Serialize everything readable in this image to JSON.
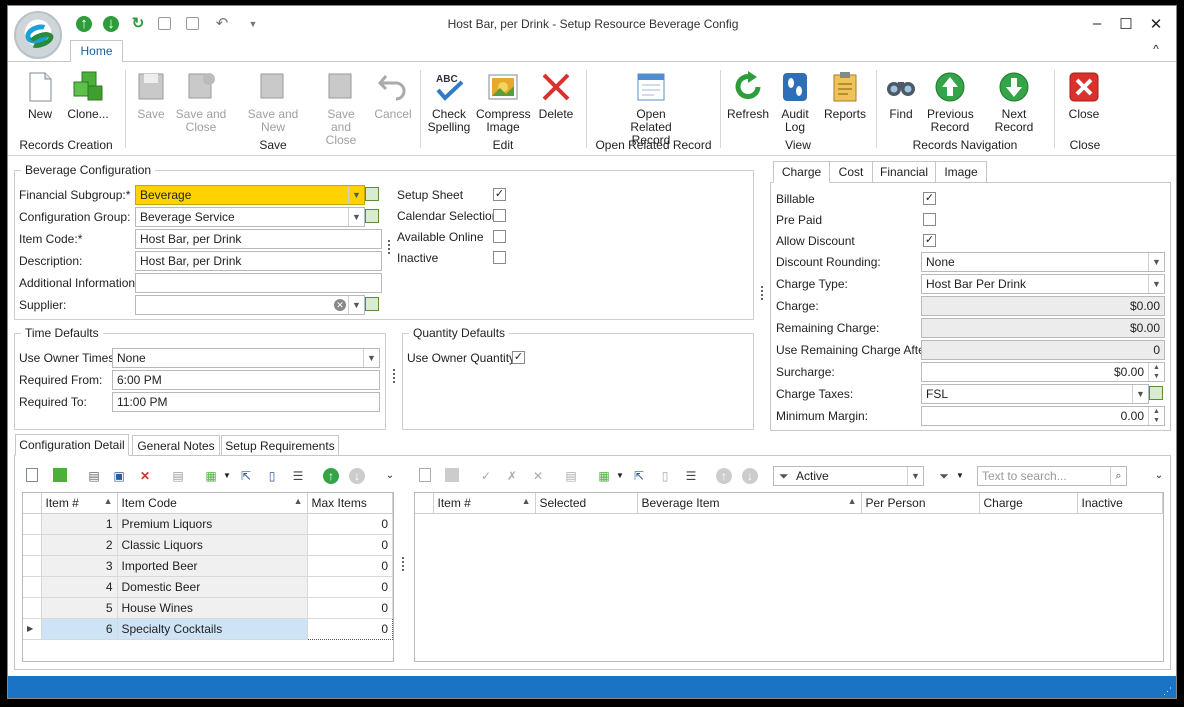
{
  "window": {
    "title": "Host Bar, per Drink - Setup Resource Beverage Config",
    "minimize": "–",
    "maximize": "☐",
    "close": "✕",
    "collapse": "^"
  },
  "ribbon": {
    "tab": "Home",
    "buttons": [
      {
        "label": "New"
      },
      {
        "label": "Clone..."
      },
      {
        "label": "Save"
      },
      {
        "label": "Save and Close"
      },
      {
        "label": "Save and New"
      },
      {
        "label": "Save and Close"
      },
      {
        "label": "Cancel"
      },
      {
        "label": "Check Spelling"
      },
      {
        "label": "Compress Image"
      },
      {
        "label": "Delete"
      },
      {
        "label": "Open Related Record"
      },
      {
        "label": "Refresh"
      },
      {
        "label": "Audit Log"
      },
      {
        "label": "Reports"
      },
      {
        "label": "Find"
      },
      {
        "label": "Previous Record"
      },
      {
        "label": "Next Record"
      },
      {
        "label": "Close"
      }
    ],
    "groups": [
      "Records Creation",
      "Save",
      "Edit",
      "Open Related Record",
      "View",
      "Records Navigation",
      "Close"
    ]
  },
  "beverage_config": {
    "legend": "Beverage Configuration",
    "financial_subgroup_label": "Financial Subgroup:*",
    "financial_subgroup": "Beverage",
    "config_group_label": "Configuration Group:",
    "config_group": "Beverage Service",
    "item_code_label": "Item Code:*",
    "item_code": "Host Bar, per Drink",
    "description_label": "Description:",
    "description": "Host Bar, per Drink",
    "additional_info_label": "Additional Information:",
    "additional_info": "",
    "supplier_label": "Supplier:",
    "supplier": "",
    "setup_sheet_label": "Setup Sheet",
    "calendar_selection_label": "Calendar Selection",
    "available_online_label": "Available Online",
    "inactive_label": "Inactive"
  },
  "time_defaults": {
    "legend": "Time Defaults",
    "use_owner_times_label": "Use Owner Times:",
    "use_owner_times": "None",
    "required_from_label": "Required From:",
    "required_from": "6:00 PM",
    "required_to_label": "Required To:",
    "required_to": "11:00 PM"
  },
  "quantity_defaults": {
    "legend": "Quantity Defaults",
    "use_owner_quantity_label": "Use Owner Quantity"
  },
  "right_tabs": [
    "Charge",
    "Cost",
    "Financial",
    "Image"
  ],
  "charge": {
    "billable_label": "Billable",
    "pre_paid_label": "Pre Paid",
    "allow_discount_label": "Allow Discount",
    "discount_rounding_label": "Discount Rounding:",
    "discount_rounding": "None",
    "charge_type_label": "Charge Type:",
    "charge_type": "Host Bar Per Drink",
    "charge_label": "Charge:",
    "charge": "$0.00",
    "remaining_charge_label": "Remaining Charge:",
    "remaining_charge": "$0.00",
    "use_remaining_after_label": "Use Remaining Charge After:",
    "use_remaining_after": "0",
    "surcharge_label": "Surcharge:",
    "surcharge": "$0.00",
    "charge_taxes_label": "Charge Taxes:",
    "charge_taxes": "FSL",
    "minimum_margin_label": "Minimum Margin:",
    "minimum_margin": "0.00"
  },
  "bottom_tabs": [
    "Configuration Detail",
    "General Notes",
    "Setup Requirements"
  ],
  "left_grid": {
    "headers": [
      "Item #",
      "Item Code",
      "Max Items"
    ],
    "rows": [
      {
        "num": "1",
        "code": "Premium Liquors",
        "max": "0"
      },
      {
        "num": "2",
        "code": "Classic Liquors",
        "max": "0"
      },
      {
        "num": "3",
        "code": "Imported Beer",
        "max": "0"
      },
      {
        "num": "4",
        "code": "Domestic Beer",
        "max": "0"
      },
      {
        "num": "5",
        "code": "House Wines",
        "max": "0"
      },
      {
        "num": "6",
        "code": "Specialty Cocktails",
        "max": "0"
      }
    ]
  },
  "right_grid": {
    "filter": "Active",
    "search_placeholder": "Text to search...",
    "headers": [
      "Item #",
      "Selected",
      "Beverage Item",
      "Per Person",
      "Charge",
      "Inactive"
    ]
  },
  "colors": {
    "required": "#ffd200",
    "accent": "#1a73c5",
    "selected_row": "#cfe3f7"
  }
}
